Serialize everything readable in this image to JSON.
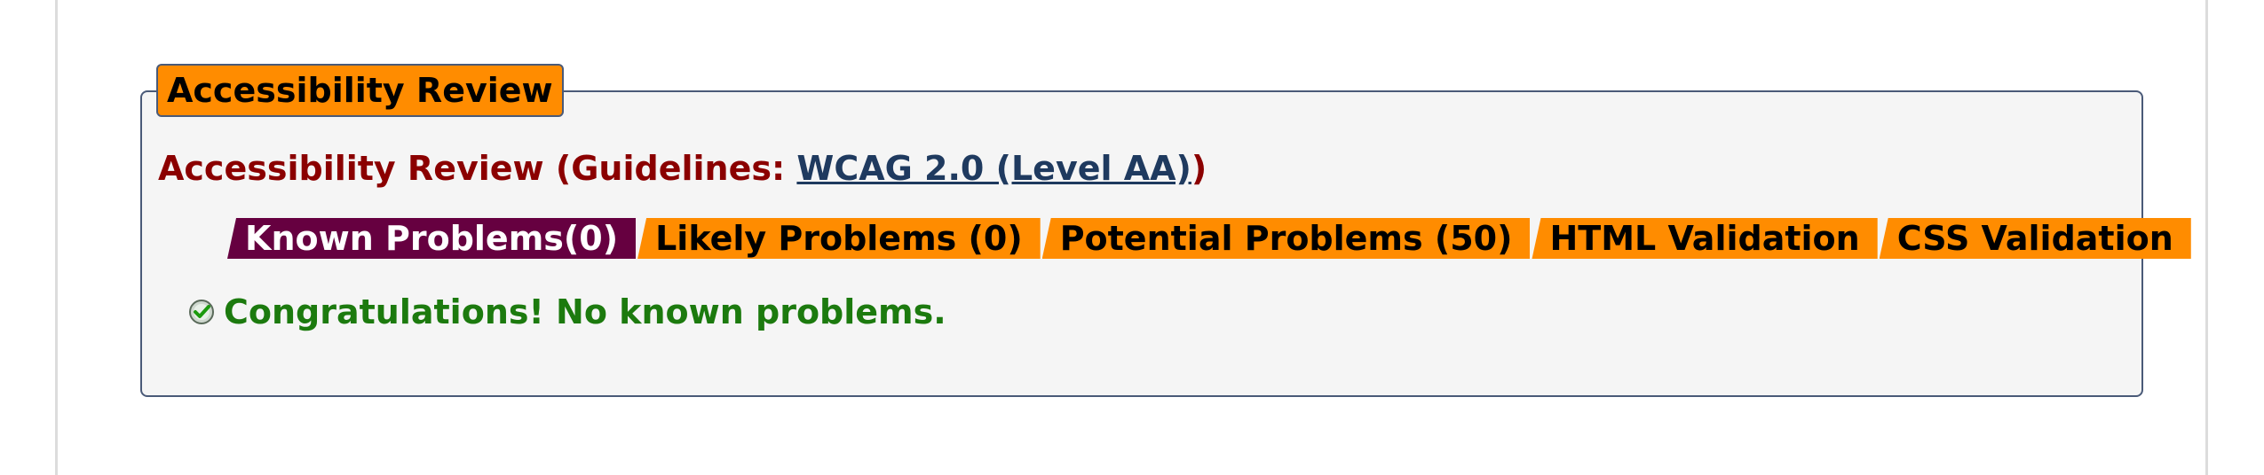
{
  "legend": {
    "label": "Accessibility Review"
  },
  "heading": {
    "prefix": "Accessibility Review (Guidelines: ",
    "link_label": "WCAG 2.0 (Level AA)",
    "suffix": ")"
  },
  "tabs": [
    {
      "label": "Known Problems(0)",
      "active": true
    },
    {
      "label": "Likely Problems (0)",
      "active": false
    },
    {
      "label": "Potential Problems (50)",
      "active": false
    },
    {
      "label": "HTML Validation",
      "active": false
    },
    {
      "label": "CSS Validation",
      "active": false
    }
  ],
  "result": {
    "icon": "check-circle-icon",
    "message": "Congratulations! No known problems."
  },
  "colors": {
    "accent_orange": "#ff8c00",
    "active_tab": "#660040",
    "heading": "#8b0000",
    "link": "#1f3a5f",
    "success": "#1c7a0e"
  }
}
